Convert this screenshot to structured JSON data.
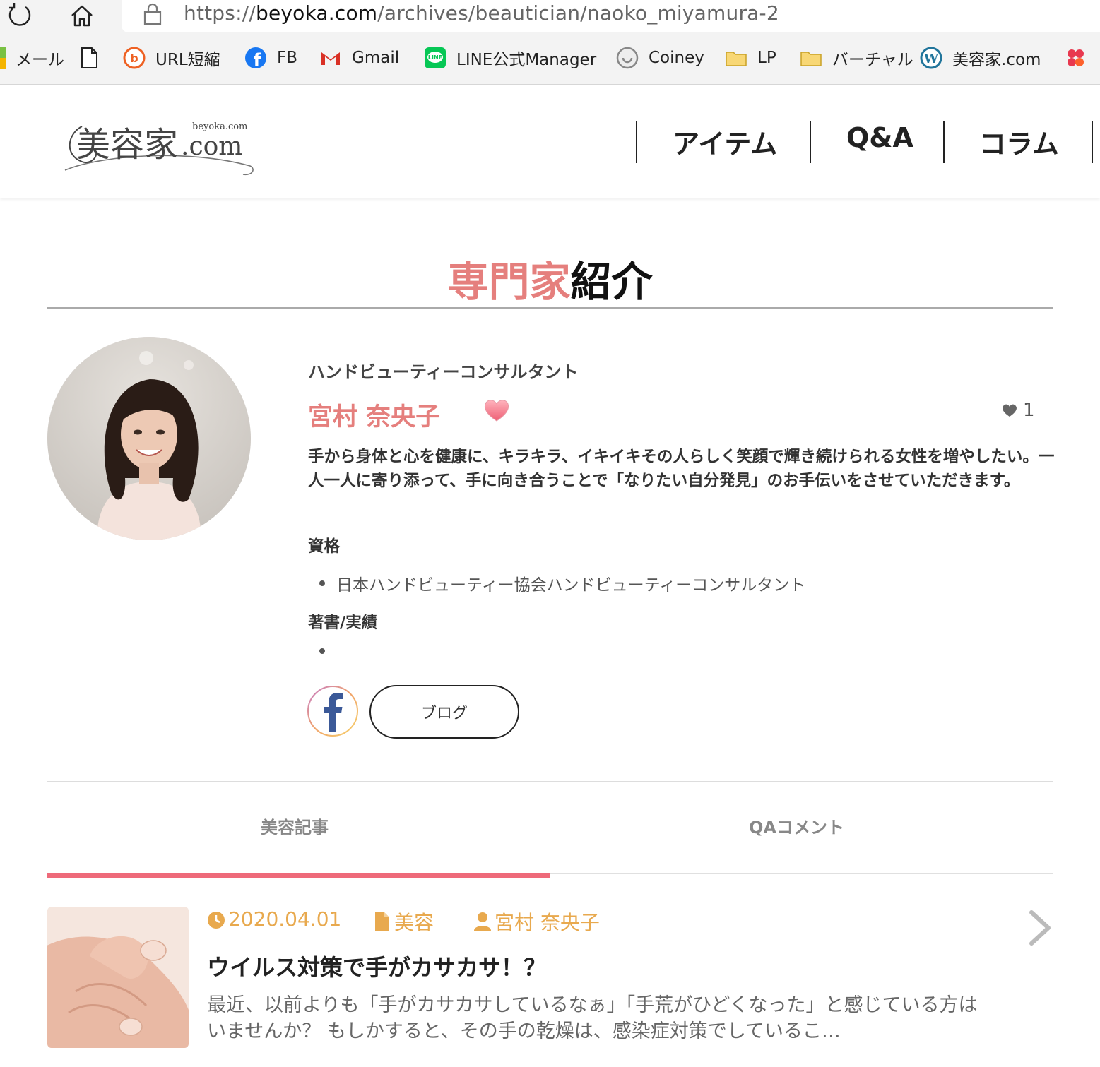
{
  "browser": {
    "url_prefix": "https://",
    "url_domain": "beyoka.com",
    "url_path": "/archives/beautician/naoko_miyamura-2",
    "bookmarks": [
      {
        "label": "メール",
        "icon": "mail-icon"
      },
      {
        "label": "",
        "icon": "page-icon"
      },
      {
        "label": "URL短縮",
        "icon": "bitly-icon"
      },
      {
        "label": "FB",
        "icon": "facebook-icon"
      },
      {
        "label": "Gmail",
        "icon": "gmail-icon"
      },
      {
        "label": "LINE公式Manager",
        "icon": "line-icon"
      },
      {
        "label": "Coiney",
        "icon": "coiney-icon"
      },
      {
        "label": "LP",
        "icon": "folder-icon"
      },
      {
        "label": "バーチャル",
        "icon": "folder-icon"
      },
      {
        "label": "美容家.com",
        "icon": "wordpress-icon"
      }
    ]
  },
  "site": {
    "logo_text": "美容家.com",
    "logo_sub": "beyoka.com",
    "nav": [
      "アイテム",
      "Q&A",
      "コラム"
    ]
  },
  "page": {
    "title_accent": "専門家",
    "title_rest": "紹介"
  },
  "profile": {
    "role": "ハンドビューティーコンサルタント",
    "name": "宮村 奈央子",
    "likes": "1",
    "intro": "手から身体と心を健康に、キラキラ、イキイキその人らしく笑顔で輝き続けられる女性を増やしたい。一人一人に寄り添って、手に向き合うことで「なりたい自分発見」のお手伝いをさせていただきます。",
    "qual_title": "資格",
    "qualifications": [
      "日本ハンドビューティー協会ハンドビューティーコンサルタント"
    ],
    "works_title": "著書/実績",
    "works": [
      ""
    ],
    "blog_label": "ブログ"
  },
  "tabs": {
    "articles": "美容記事",
    "qa": "QAコメント",
    "active": "articles"
  },
  "article": {
    "date": "2020.04.01",
    "category": "美容",
    "author": "宮村 奈央子",
    "title": "ウイルス対策で手がカサカサ！？",
    "excerpt": "最近、以前よりも「手がカサカサしているなぁ」「手荒がひどくなった」と感じている方はいませんか？ もしかすると、その手の乾燥は、感染症対策でしているこ…"
  },
  "colors": {
    "accent_pink": "#e57f7d",
    "tab_active": "#ee6a7a",
    "meta_orange": "#e8a94e"
  }
}
